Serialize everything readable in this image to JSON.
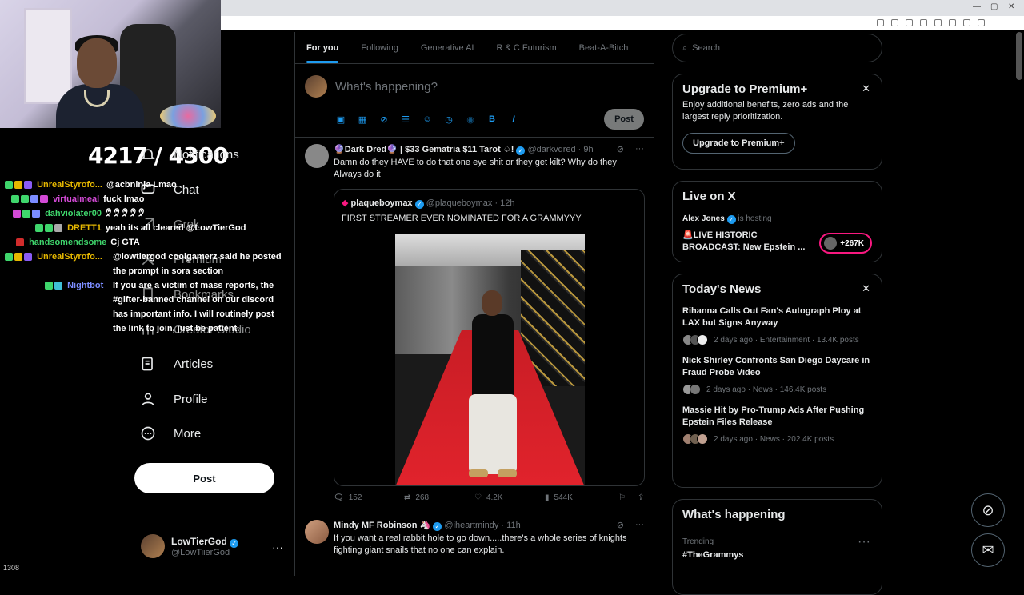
{
  "overlay": {
    "sub_counter": "4217 / 4300",
    "viewers": "1308"
  },
  "nav": {
    "items": [
      {
        "label": "Notifications",
        "icon": "bell-icon"
      },
      {
        "label": "Chat",
        "icon": "chat-icon"
      },
      {
        "label": "Grok",
        "icon": "grok-icon"
      },
      {
        "label": "Premium",
        "icon": "x-icon"
      },
      {
        "label": "Bookmarks",
        "icon": "bookmark-icon"
      },
      {
        "label": "Creator Studio",
        "icon": "creator-studio-icon"
      },
      {
        "label": "Articles",
        "icon": "articles-icon"
      },
      {
        "label": "Profile",
        "icon": "person-icon"
      },
      {
        "label": "More",
        "icon": "more-circle-icon"
      }
    ],
    "post_label": "Post",
    "user": {
      "name": "LowTierGod",
      "handle": "@LowTiierGod",
      "more": "···"
    }
  },
  "chat": [
    {
      "name": "UnrealStyrofo...",
      "color": "#e6b800",
      "msg": "@acbninja Lmao"
    },
    {
      "name": "virtualmeal",
      "color": "#d34ad6",
      "msg": "fuck lmao"
    },
    {
      "name": "dahviolater00",
      "color": "#3fd66c",
      "msg": "🤋 🤋 🤋 🤋 🤋"
    },
    {
      "name": "DRETT1",
      "color": "#e6b800",
      "msg": "yeah its all cleared @LowTierGod"
    },
    {
      "name": "handsomendsome",
      "color": "#3fd66c",
      "msg": "Cj GTA"
    },
    {
      "name": "UnrealStyrofo...",
      "color": "#e6b800",
      "msg": "@lowtiergod coolgamerz said he posted the prompt in sora section"
    },
    {
      "name": "Nightbot",
      "color": "#7b8cff",
      "msg": "If you are a victim of mass reports, the #gifter-banned channel on our discord has important info. I will routinely post the link to join, just be patient."
    }
  ],
  "feed": {
    "tabs": [
      "For you",
      "Following",
      "Generative AI",
      "R & C Futurism",
      "Beat-A-Bitch"
    ],
    "composer_placeholder": "What's happening?",
    "composer_post": "Post",
    "composer_tools": [
      "image-icon",
      "gif-icon",
      "grok-icon",
      "poll-icon",
      "emoji-icon",
      "schedule-icon",
      "location-icon",
      "bold-icon",
      "italic-icon"
    ],
    "tweet1": {
      "name": "🔮Dark Dred🔮 | $33 Gematria $11 Tarot ♤!",
      "handle": "@darkvdred · 9h",
      "text": "Damn do they HAVE to do that one eye shit or they get kilt? Why do they Always do it",
      "quote_name": "plaqueboymax",
      "quote_handle": "@plaqueboymax · 12h",
      "quote_text": "FIRST STREAMER EVER NOMINATED FOR A GRAMMYYY",
      "replies": "152",
      "reposts": "268",
      "likes": "4.2K",
      "views": "544K"
    },
    "tweet2": {
      "name": "Mindy MF Robinson 🦄",
      "handle": "@iheartmindy · 11h",
      "text": "If you want a real rabbit hole to go down.....there's a whole series of knights fighting giant snails that no one can explain."
    }
  },
  "sidebar": {
    "search_placeholder": "Search",
    "premium": {
      "title": "Upgrade to Premium+",
      "body": "Enjoy additional benefits, zero ads and the largest reply prioritization.",
      "button": "Upgrade to Premium+"
    },
    "live": {
      "title": "Live on X",
      "host": "Alex Jones",
      "hosting": "is hosting",
      "stream": "🚨LIVE HISTORIC BROADCAST: New Epstein ...",
      "count": "+267K"
    },
    "news": {
      "title": "Today's News",
      "items": [
        {
          "title": "Rihanna Calls Out Fan's Autograph Ploy at LAX but Signs Anyway",
          "meta": "2 days ago · Entertainment · 13.4K posts"
        },
        {
          "title": "Nick Shirley Confronts San Diego Daycare in Fraud Probe Video",
          "meta": "2 days ago · News · 146.4K posts"
        },
        {
          "title": "Massie Hit by Pro-Trump Ads After Pushing Epstein Files Release",
          "meta": "2 days ago · News · 202.4K posts"
        }
      ]
    },
    "happening": {
      "title": "What's happening",
      "trend_label": "Trending",
      "trend": "#TheGrammys",
      "more": "···"
    }
  },
  "colors": {
    "accent": "#1d9bf0",
    "live_ring": "#f91880",
    "background": "#000000"
  }
}
